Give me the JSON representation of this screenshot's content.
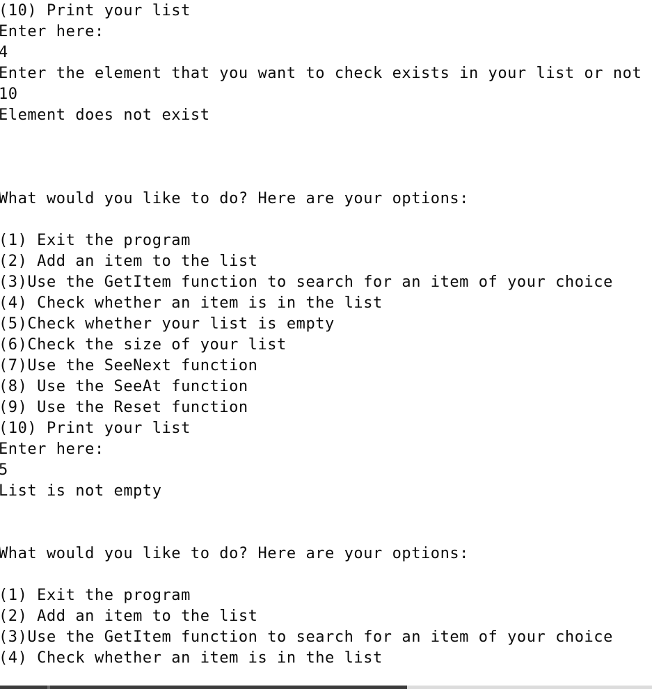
{
  "console": {
    "lines": [
      "(10) Print your list",
      "Enter here:",
      "4",
      "Enter the element that you want to check exists in your list or not",
      "10",
      "Element does not exist",
      "",
      "",
      "",
      "What would you like to do? Here are your options:",
      "",
      "(1) Exit the program",
      "(2) Add an item to the list",
      "(3)Use the GetItem function to search for an item of your choice",
      "(4) Check whether an item is in the list",
      "(5)Check whether your list is empty",
      "(6)Check the size of your list",
      "(7)Use the SeeNext function",
      "(8) Use the SeeAt function",
      "(9) Use the Reset function",
      "(10) Print your list",
      "Enter here:",
      "5",
      "List is not empty",
      "",
      "",
      "What would you like to do? Here are your options:",
      "",
      "(1) Exit the program",
      "(2) Add an item to the list",
      "(3)Use the GetItem function to search for an item of your choice",
      "(4) Check whether an item is in the list"
    ]
  }
}
